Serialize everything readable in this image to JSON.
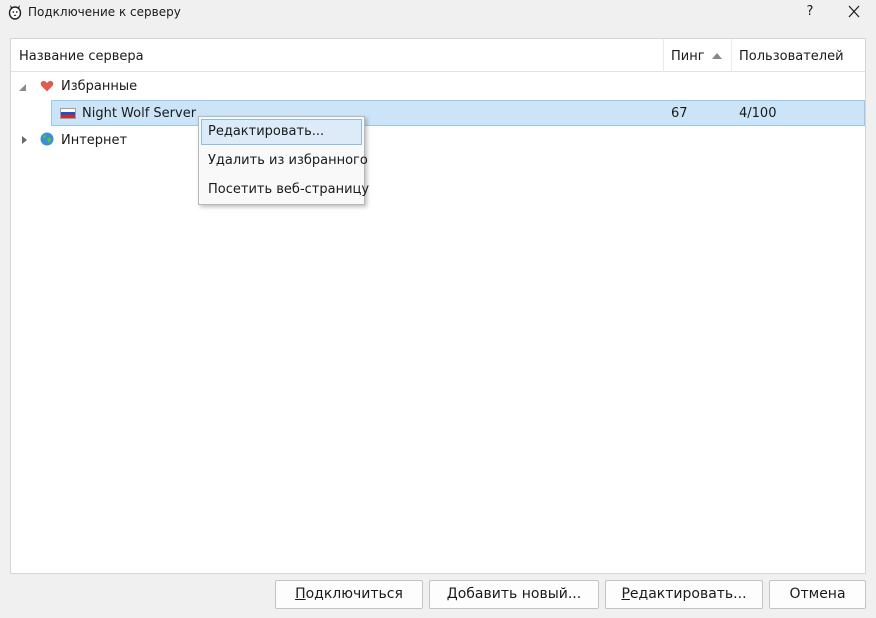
{
  "window": {
    "title": "Подключение к серверу",
    "help_label": "?"
  },
  "columns": {
    "name": "Название сервера",
    "ping": "Пинг",
    "users": "Пользователей",
    "sort": "ping-ascending"
  },
  "tree": {
    "favorites": {
      "label": "Избранные",
      "icon": "heart-icon",
      "expanded": true
    },
    "server": {
      "name": "Night Wolf Server",
      "flag": "russia-flag-icon",
      "ping": "67",
      "users": "4/100",
      "selected": true
    },
    "internet": {
      "label": "Интернет",
      "icon": "globe-icon",
      "expanded": false
    }
  },
  "context_menu": {
    "items": [
      {
        "label": "Редактировать...",
        "highlighted": true
      },
      {
        "label": "Удалить из избранного",
        "highlighted": false
      },
      {
        "label": "Посетить веб-страницу",
        "highlighted": false
      }
    ]
  },
  "buttons": {
    "connect": {
      "mnemonic": "П",
      "rest": "одключиться"
    },
    "add": {
      "mnemonic": "Д",
      "rest": "обавить новый..."
    },
    "edit": {
      "mnemonic": "Р",
      "rest": "едактировать..."
    },
    "cancel": {
      "label": "Отмена"
    }
  },
  "colors": {
    "selection_bg": "#cce4f7",
    "selection_border": "#99c9ef",
    "heart": "#e05a4f",
    "menu_highlight": "#dcebf7"
  }
}
